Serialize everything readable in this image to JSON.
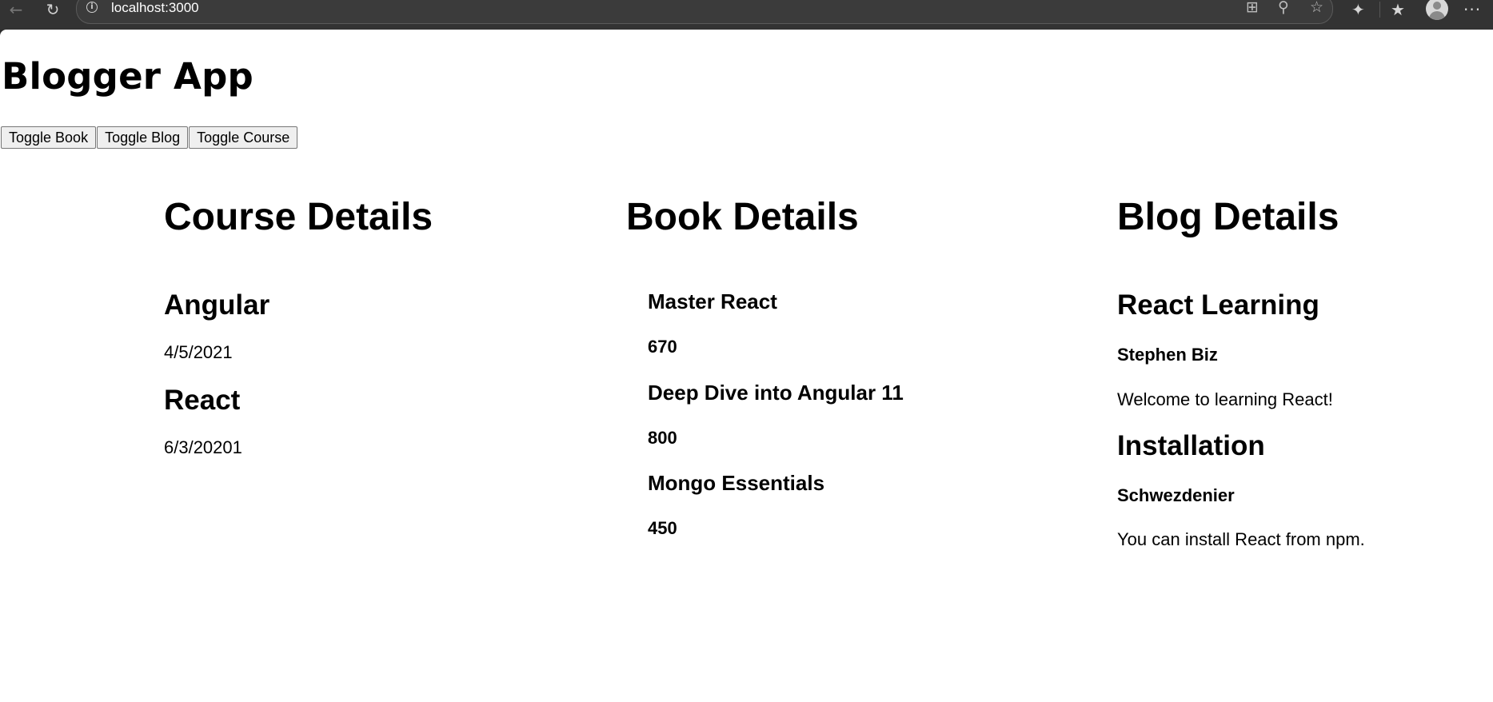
{
  "browser": {
    "url": "localhost:3000"
  },
  "app": {
    "title": "Blogger App",
    "buttons": {
      "toggle_book": "Toggle Book",
      "toggle_blog": "Toggle Blog",
      "toggle_course": "Toggle Course"
    }
  },
  "course": {
    "title": "Course Details",
    "items": [
      {
        "name": "Angular",
        "date": "4/5/2021"
      },
      {
        "name": "React",
        "date": "6/3/20201"
      }
    ]
  },
  "book": {
    "title": "Book Details",
    "items": [
      {
        "name": "Master React",
        "price": "670"
      },
      {
        "name": "Deep Dive into Angular 11",
        "price": "800"
      },
      {
        "name": "Mongo Essentials",
        "price": "450"
      }
    ]
  },
  "blog": {
    "title": "Blog Details",
    "items": [
      {
        "title": "React Learning",
        "author": "Stephen Biz",
        "content": "Welcome to learning React!"
      },
      {
        "title": "Installation",
        "author": "Schwezdenier",
        "content": "You can install React from npm."
      }
    ]
  }
}
